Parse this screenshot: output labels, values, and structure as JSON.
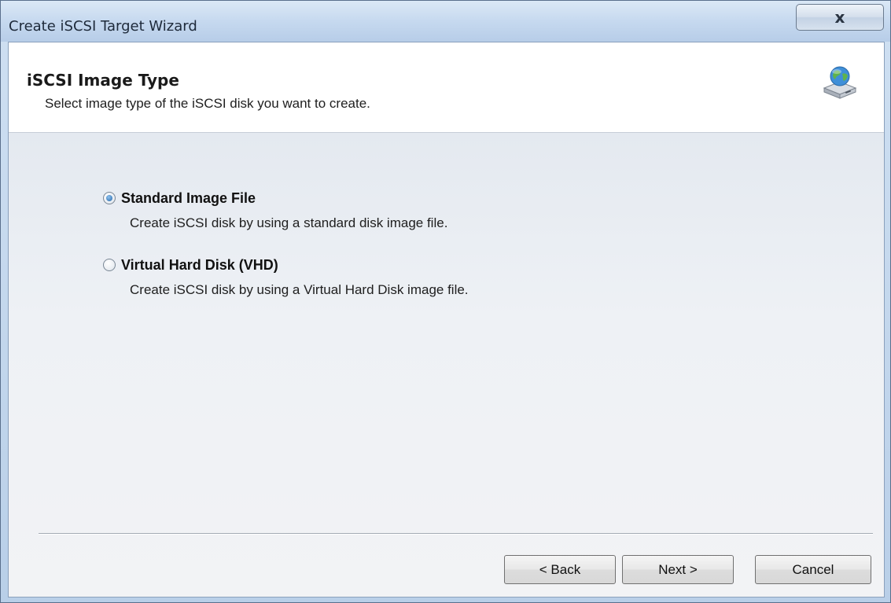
{
  "window": {
    "title": "Create iSCSI Target Wizard",
    "close_label": "x"
  },
  "header": {
    "title": "iSCSI Image Type",
    "subtitle": "Select image type of the iSCSI disk you want to create."
  },
  "options": [
    {
      "label": "Standard Image File",
      "description": "Create iSCSI disk by using a standard disk image file.",
      "selected": true
    },
    {
      "label": "Virtual Hard Disk (VHD)",
      "description": "Create iSCSI disk by using a Virtual Hard Disk image file.",
      "selected": false
    }
  ],
  "buttons": {
    "back": "< Back",
    "next": "Next >",
    "cancel": "Cancel"
  },
  "icons": {
    "header_icon": "network-disk-icon",
    "close": "close-icon"
  }
}
